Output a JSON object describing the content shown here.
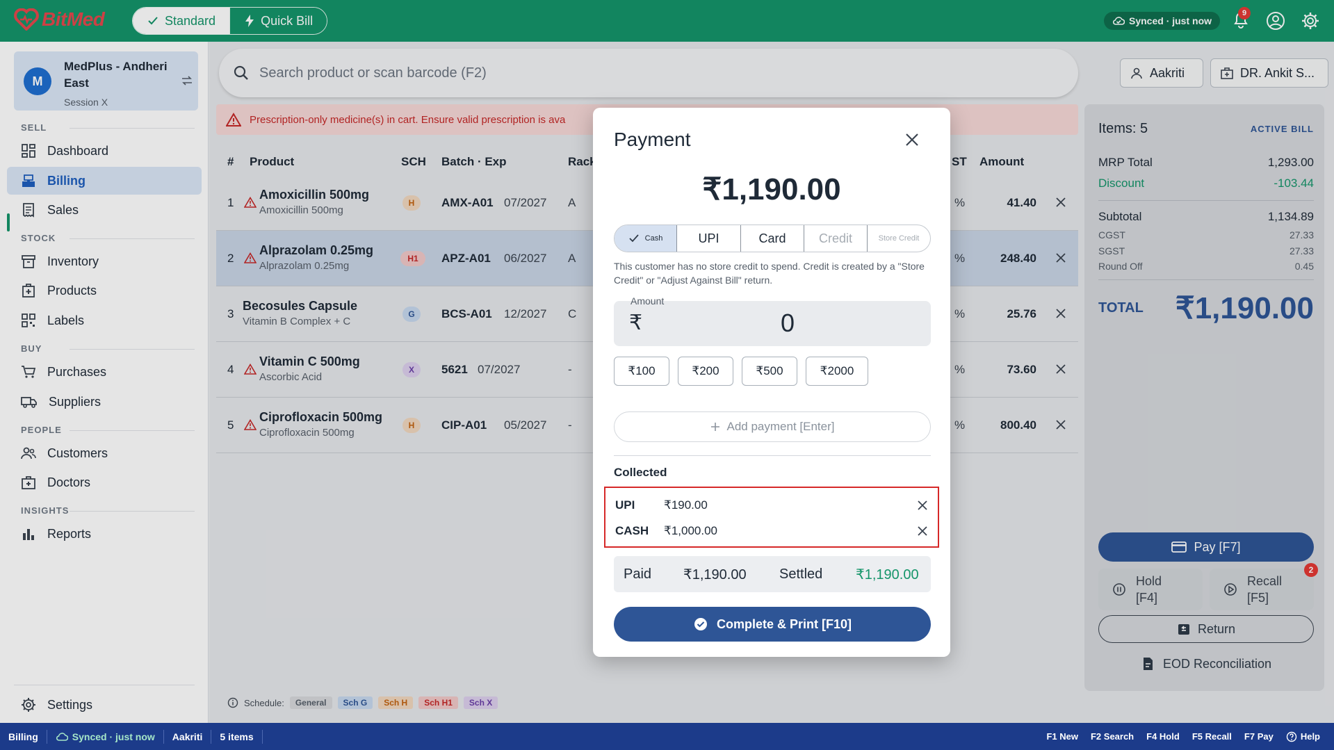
{
  "app": {
    "brand": "BitMed",
    "mode_standard": "Standard",
    "mode_quick": "Quick Bill",
    "sync_status": "Synced · just now",
    "notification_count": "9"
  },
  "store": {
    "avatar": "M",
    "name": "MedPlus - Andheri East",
    "session": "Session X"
  },
  "nav": {
    "sell_label": "SELL",
    "stock_label": "STOCK",
    "buy_label": "BUY",
    "people_label": "PEOPLE",
    "insights_label": "INSIGHTS",
    "dashboard": "Dashboard",
    "billing": "Billing",
    "sales": "Sales",
    "inventory": "Inventory",
    "products": "Products",
    "labels": "Labels",
    "purchases": "Purchases",
    "suppliers": "Suppliers",
    "customers": "Customers",
    "doctors": "Doctors",
    "reports": "Reports",
    "settings": "Settings"
  },
  "search": {
    "placeholder": "Search product or scan barcode (F2)"
  },
  "chips": {
    "customer": "Aakriti",
    "doctor": "DR. Ankit S..."
  },
  "alert": {
    "text": "Prescription-only medicine(s) in cart. Ensure valid prescription is ava"
  },
  "table": {
    "headers": {
      "num": "#",
      "product": "Product",
      "sch": "SCH",
      "batch": "Batch · Exp",
      "rack": "Rack",
      "gst": "ST",
      "amount": "Amount"
    },
    "rows": [
      {
        "num": "1",
        "name": "Amoxicillin 500mg",
        "generic": "Amoxicillin 500mg",
        "sch": "H",
        "batch": "AMX-A01",
        "exp": "07/2027",
        "rack": "A",
        "gst": "%",
        "amount": "41.40",
        "warn": true
      },
      {
        "num": "2",
        "name": "Alprazolam 0.25mg",
        "generic": "Alprazolam 0.25mg",
        "sch": "H1",
        "batch": "APZ-A01",
        "exp": "06/2027",
        "rack": "A",
        "gst": "%",
        "amount": "248.40",
        "warn": true
      },
      {
        "num": "3",
        "name": "Becosules Capsule",
        "generic": "Vitamin B Complex + C",
        "sch": "G",
        "batch": "BCS-A01",
        "exp": "12/2027",
        "rack": "C",
        "gst": "%",
        "amount": "25.76",
        "warn": false
      },
      {
        "num": "4",
        "name": "Vitamin C 500mg",
        "generic": "Ascorbic Acid",
        "sch": "X",
        "batch": "5621",
        "exp": "07/2027",
        "rack": "-",
        "gst": "%",
        "amount": "73.60",
        "warn": true
      },
      {
        "num": "5",
        "name": "Ciprofloxacin 500mg",
        "generic": "Ciprofloxacin 500mg",
        "sch": "H",
        "batch": "CIP-A01",
        "exp": "05/2027",
        "rack": "-",
        "gst": "%",
        "amount": "800.40",
        "warn": true
      }
    ]
  },
  "schedule_legend": {
    "label": "Schedule:",
    "general": "General",
    "g": "Sch G",
    "h": "Sch H",
    "h1": "Sch H1",
    "x": "Sch X"
  },
  "bill": {
    "items": "Items: 5",
    "status": "ACTIVE BILL",
    "mrp_label": "MRP Total",
    "mrp": "1,293.00",
    "discount_label": "Discount",
    "discount": "-103.44",
    "subtotal_label": "Subtotal",
    "subtotal": "1,134.89",
    "cgst_label": "CGST",
    "cgst": "27.33",
    "sgst_label": "SGST",
    "sgst": "27.33",
    "roundoff_label": "Round Off",
    "roundoff": "0.45",
    "total_label": "TOTAL",
    "total": "₹1,190.00",
    "pay": "Pay  [F7]",
    "hold": "Hold",
    "hold_key": "[F4]",
    "recall": "Recall",
    "recall_key": "[F5]",
    "recall_count": "2",
    "return": "Return",
    "eod": "EOD Reconciliation"
  },
  "payment": {
    "title": "Payment",
    "amount_due": "₹1,190.00",
    "methods": {
      "cash": "Cash",
      "upi": "UPI",
      "card": "Card",
      "credit": "Credit",
      "store_credit": "Store Credit"
    },
    "credit_note": "This customer has no store credit to spend. Credit is created by a \"Store Credit\" or \"Adjust Against Bill\" return.",
    "amount_label": "Amount",
    "currency": "₹",
    "amount_value": "0",
    "quick": [
      "₹100",
      "₹200",
      "₹500",
      "₹2000"
    ],
    "add_payment": "Add payment  [Enter]",
    "collected_label": "Collected",
    "collected": [
      {
        "method": "UPI",
        "amount": "₹190.00"
      },
      {
        "method": "CASH",
        "amount": "₹1,000.00"
      }
    ],
    "paid_label": "Paid",
    "paid": "₹1,190.00",
    "settled_label": "Settled",
    "settled": "₹1,190.00",
    "complete": "Complete & Print  [F10]"
  },
  "statusbar": {
    "page": "Billing",
    "sync": "Synced · just now",
    "user": "Aakriti",
    "items": "5 items",
    "shortcuts": [
      "F1 New",
      "F2 Search",
      "F4 Hold",
      "F5 Recall",
      "F7 Pay"
    ],
    "help": "Help"
  },
  "colors": {
    "brand_green": "#15956a",
    "primary_blue": "#2e5596",
    "alert_red": "#d62828",
    "settled_green": "#15956a"
  }
}
